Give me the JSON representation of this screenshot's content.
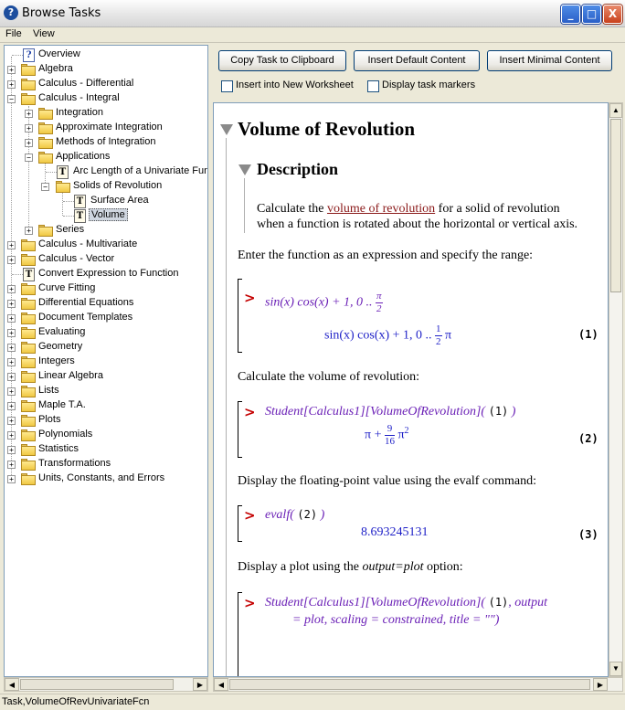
{
  "window": {
    "title": "Browse Tasks",
    "minimize": "_",
    "maximize": "□",
    "close": "X",
    "app_icon": "?"
  },
  "menu": {
    "file": "File",
    "view": "View"
  },
  "tree": {
    "items": [
      {
        "label": "Overview",
        "icon": "help-icon",
        "glyph": "?"
      },
      {
        "label": "Algebra",
        "icon": "folder-icon"
      },
      {
        "label": "Calculus - Differential",
        "icon": "folder-icon"
      },
      {
        "label": "Calculus - Integral",
        "icon": "folder-icon"
      },
      {
        "label": "Integration",
        "icon": "folder-icon"
      },
      {
        "label": "Approximate Integration",
        "icon": "folder-icon"
      },
      {
        "label": "Methods of Integration",
        "icon": "folder-icon"
      },
      {
        "label": "Applications",
        "icon": "folder-icon"
      },
      {
        "label": "Arc Length of a Univariate Fun",
        "icon": "task-icon",
        "glyph": "T"
      },
      {
        "label": "Solids of Revolution",
        "icon": "folder-icon"
      },
      {
        "label": "Surface Area",
        "icon": "task-icon",
        "glyph": "T"
      },
      {
        "label": "Volume",
        "icon": "task-icon",
        "glyph": "T"
      },
      {
        "label": "Series",
        "icon": "folder-icon"
      },
      {
        "label": "Calculus - Multivariate",
        "icon": "folder-icon"
      },
      {
        "label": "Calculus - Vector",
        "icon": "folder-icon"
      },
      {
        "label": "Convert Expression to Function",
        "icon": "task-icon",
        "glyph": "T"
      },
      {
        "label": "Curve Fitting",
        "icon": "folder-icon"
      },
      {
        "label": "Differential Equations",
        "icon": "folder-icon"
      },
      {
        "label": "Document Templates",
        "icon": "folder-icon"
      },
      {
        "label": "Evaluating",
        "icon": "folder-icon"
      },
      {
        "label": "Geometry",
        "icon": "folder-icon"
      },
      {
        "label": "Integers",
        "icon": "folder-icon"
      },
      {
        "label": "Linear Algebra",
        "icon": "folder-icon"
      },
      {
        "label": "Lists",
        "icon": "folder-icon"
      },
      {
        "label": "Maple T.A.",
        "icon": "folder-icon"
      },
      {
        "label": "Plots",
        "icon": "folder-icon"
      },
      {
        "label": "Polynomials",
        "icon": "folder-icon"
      },
      {
        "label": "Statistics",
        "icon": "folder-icon"
      },
      {
        "label": "Transformations",
        "icon": "folder-icon"
      },
      {
        "label": "Units, Constants, and Errors",
        "icon": "folder-icon"
      }
    ],
    "selected": "Volume"
  },
  "toolbar": {
    "copy_label": "Copy Task to Clipboard",
    "insert_default_label": "Insert Default Content",
    "insert_minimal_label": "Insert Minimal Content",
    "insert_new_worksheet": "Insert into New Worksheet",
    "display_task_markers": "Display task markers",
    "insert_new_worksheet_checked": false,
    "display_task_markers_checked": false
  },
  "doc": {
    "title": "Volume of Revolution",
    "description_heading": "Description",
    "desc_pre": "Calculate the ",
    "desc_link": "volume of revolution",
    "desc_post": " for a solid of revolution",
    "desc_line2": "when a function is rotated about the horizontal or vertical axis.",
    "para1": "Enter the function as an expression and specify the range:",
    "para2": "Calculate the volume of revolution:",
    "para3": "Display the floating-point value using the evalf command:",
    "para4_pre": "Display a plot using the ",
    "para4_em": "output=plot",
    "para4_post": " option:",
    "prompt": ">",
    "in1_expr": "sin(x) cos(x) + 1, 0 ..",
    "in1_num": "π",
    "in1_den": "2",
    "out1_expr": "sin(x) cos(x) + 1, 0 ..",
    "out1_num": "1",
    "out1_den": "2",
    "out1_tail": "π",
    "label1": "(1)",
    "in2_expr": "Student[Calculus1][VolumeOfRevolution](",
    "in2_ref": "(1)",
    "in2_close": ")",
    "out2_pre": "π +",
    "out2_num": "9",
    "out2_den": "16",
    "out2_post": "π",
    "out2_exp": "2",
    "label2": "(2)",
    "in3_expr": "evalf(",
    "in3_ref": "(2)",
    "in3_close": ")",
    "out3": "8.693245131",
    "label3": "(3)",
    "in4_expr": "Student[Calculus1][VolumeOfRevolution](",
    "in4_ref": "(1)",
    "in4_tail": ", output",
    "in4_line2": "= plot, scaling = constrained, title = \"\")"
  },
  "status": {
    "text": "Task,VolumeOfRevUnivariateFcn"
  },
  "colors": {
    "prompt": "#c40000",
    "input": "#6a1fb6",
    "output": "#1d1fc7",
    "link": "#8b1a1a",
    "selection": "#cfd6e0"
  }
}
